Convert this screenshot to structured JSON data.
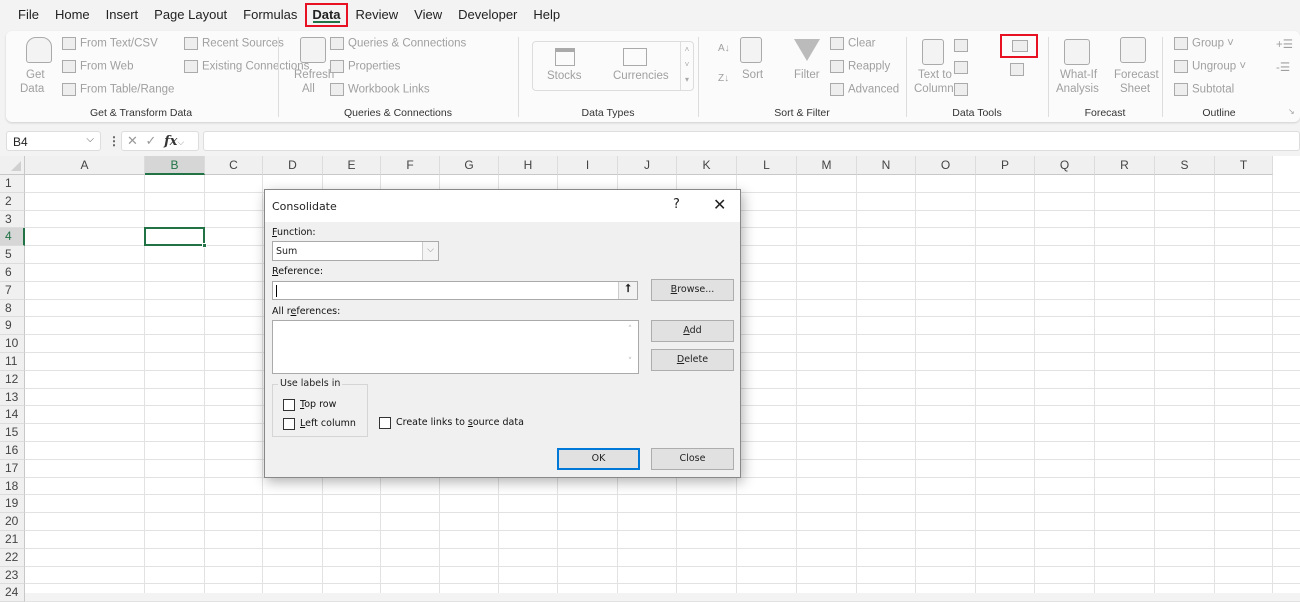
{
  "menu": {
    "tabs": [
      "File",
      "Home",
      "Insert",
      "Page Layout",
      "Formulas",
      "Data",
      "Review",
      "View",
      "Developer",
      "Help"
    ],
    "active": "Data"
  },
  "ribbon": {
    "get_transform": {
      "get_data": [
        "Get",
        "Data"
      ],
      "from_text_csv": "From Text/CSV",
      "from_web": "From Web",
      "from_table_range": "From Table/Range",
      "recent_sources": "Recent Sources",
      "existing_connections": "Existing Connections",
      "label": "Get & Transform Data"
    },
    "queries": {
      "refresh_all": [
        "Refresh",
        "All"
      ],
      "queries_connections": "Queries & Connections",
      "properties": "Properties",
      "workbook_links": "Workbook Links",
      "label": "Queries & Connections"
    },
    "data_types": {
      "stocks": "Stocks",
      "currencies": "Currencies",
      "label": "Data Types"
    },
    "sort_filter": {
      "sort": "Sort",
      "filter": "Filter",
      "clear": "Clear",
      "reapply": "Reapply",
      "advanced": "Advanced",
      "label": "Sort & Filter"
    },
    "data_tools": {
      "text_to_columns": [
        "Text to",
        "Columns"
      ],
      "label": "Data Tools",
      "highlighted": "consolidate-icon"
    },
    "forecast": {
      "what_if": [
        "What-If",
        "Analysis"
      ],
      "forecast_sheet": [
        "Forecast",
        "Sheet"
      ],
      "label": "Forecast"
    },
    "outline": {
      "group": "Group",
      "ungroup": "Ungroup",
      "subtotal": "Subtotal",
      "label": "Outline"
    }
  },
  "formula_bar": {
    "name_box": "B4",
    "formula": ""
  },
  "sheet": {
    "columns": [
      "A",
      "B",
      "C",
      "D",
      "E",
      "F",
      "G",
      "H",
      "I",
      "J",
      "K",
      "L",
      "M",
      "N",
      "O",
      "P",
      "Q",
      "R",
      "S",
      "T"
    ],
    "rows": [
      "1",
      "2",
      "3",
      "4",
      "5",
      "6",
      "7",
      "8",
      "9",
      "10",
      "11",
      "12",
      "13",
      "14",
      "15",
      "16",
      "17",
      "18",
      "19",
      "20",
      "21",
      "22",
      "23",
      "24"
    ],
    "selected_cell": "B4"
  },
  "dialog": {
    "title": "Consolidate",
    "help": "?",
    "close": "✕",
    "function_label": "unction:",
    "function_label_u": "F",
    "function_value": "Sum",
    "reference_label": "eference:",
    "reference_label_u": "R",
    "reference_value": "",
    "all_references_label_a": "All r",
    "all_references_label_u": "e",
    "all_references_label_b": "ferences:",
    "browse_u": "B",
    "browse": "rowse...",
    "add_u": "A",
    "add": "dd",
    "delete_u": "D",
    "delete": "elete",
    "use_labels_in": "Use labels in",
    "top_row_u": "T",
    "top_row": "op row",
    "left_column_u": "L",
    "left_column": "eft column",
    "create_links_a": "Create links to ",
    "create_links_u": "s",
    "create_links_b": "ource data",
    "ok": "OK",
    "close_btn": "Close",
    "checkboxes": {
      "top_row": false,
      "left_column": false,
      "create_links": false
    }
  }
}
